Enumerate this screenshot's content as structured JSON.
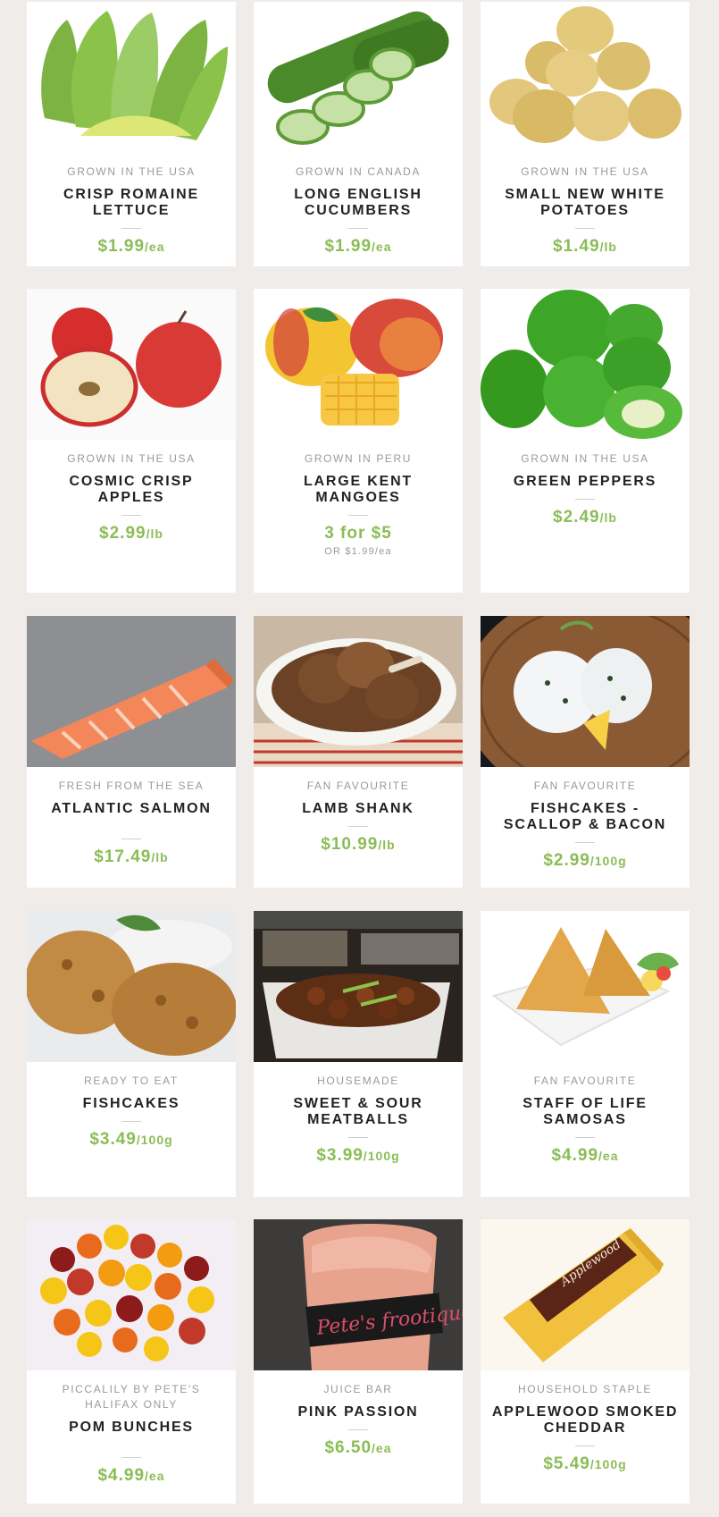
{
  "products": [
    {
      "origin": "GROWN IN THE USA",
      "name": "CRISP ROMAINE LETTUCE",
      "price": "$1.99",
      "unit": "/ea",
      "image": "romaine-lettuce"
    },
    {
      "origin": "GROWN IN CANADA",
      "name": "LONG ENGLISH CUCUMBERS",
      "price": "$1.99",
      "unit": "/ea",
      "image": "cucumbers"
    },
    {
      "origin": "GROWN IN THE USA",
      "name": "SMALL NEW WHITE POTATOES",
      "price": "$1.49",
      "unit": "/lb",
      "image": "potatoes"
    },
    {
      "origin": "GROWN IN THE USA",
      "name": "COSMIC CRISP APPLES",
      "price": "$2.99",
      "unit": "/lb",
      "image": "apples"
    },
    {
      "origin": "GROWN IN PERU",
      "name": "LARGE KENT MANGOES",
      "price": "3 for $5",
      "unit": "",
      "alt": "OR $1.99/ea",
      "image": "mangoes"
    },
    {
      "origin": "GROWN IN THE USA",
      "name": "GREEN PEPPERS",
      "price": "$2.49",
      "unit": "/lb",
      "image": "green-peppers"
    },
    {
      "origin": "FRESH FROM THE SEA",
      "name": "ATLANTIC SALMON",
      "price": "$17.49",
      "unit": "/lb",
      "image": "salmon"
    },
    {
      "origin": "FAN FAVOURITE",
      "name": "LAMB SHANK",
      "price": "$10.99",
      "unit": "/lb",
      "image": "lamb-shank"
    },
    {
      "origin": "FAN FAVOURITE",
      "name": "FISHCAKES - SCALLOP & BACON",
      "price": "$2.99",
      "unit": "/100g",
      "image": "scallop-fishcakes"
    },
    {
      "origin": "READY TO EAT",
      "name": "FISHCAKES",
      "price": "$3.49",
      "unit": "/100g",
      "image": "fishcakes"
    },
    {
      "origin": "HOUSEMADE",
      "name": "SWEET & SOUR MEATBALLS",
      "price": "$3.99",
      "unit": "/100g",
      "image": "meatballs"
    },
    {
      "origin": "FAN FAVOURITE",
      "name": "STAFF OF LIFE SAMOSAS",
      "price": "$4.99",
      "unit": "/ea",
      "image": "samosas"
    },
    {
      "origin": "PICCALILY BY PETE'S HALIFAX ONLY",
      "name": "POM BUNCHES",
      "price": "$4.99",
      "unit": "/ea",
      "image": "flowers"
    },
    {
      "origin": "JUICE BAR",
      "name": "PINK PASSION",
      "price": "$6.50",
      "unit": "/ea",
      "image": "smoothie",
      "image_text": "Pete's frootique"
    },
    {
      "origin": "HOUSEHOLD STAPLE",
      "name": "APPLEWOOD SMOKED CHEDDAR",
      "price": "$5.49",
      "unit": "/100g",
      "image": "cheddar",
      "image_text": "Applewood"
    }
  ]
}
